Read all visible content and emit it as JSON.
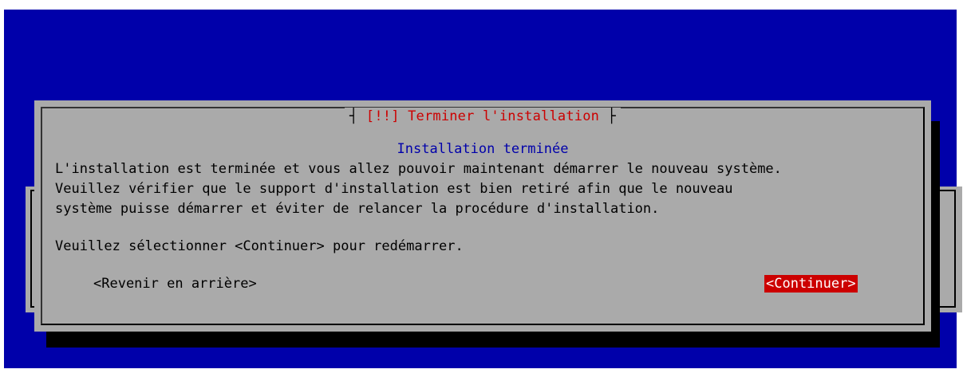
{
  "dialog": {
    "severity": "[!!]",
    "title": "Terminer l'installation",
    "subtitle": "Installation terminée",
    "body": "L'installation est terminée et vous allez pouvoir maintenant démarrer le nouveau système.\nVeuillez vérifier que le support d'installation est bien retiré afin que le nouveau\nsystème puisse démarrer et éviter de relancer la procédure d'installation.",
    "prompt": "Veuillez sélectionner <Continuer> pour redémarrer.",
    "back_label": "<Revenir en arrière>",
    "continue_label": "<Continuer>"
  },
  "colors": {
    "screen_background": "#0000aa",
    "dialog_background": "#aaaaaa",
    "title_color": "#cc0000",
    "subtitle_color": "#0000aa",
    "selected_button_background": "#cc0000",
    "selected_button_text": "#ffffff"
  }
}
